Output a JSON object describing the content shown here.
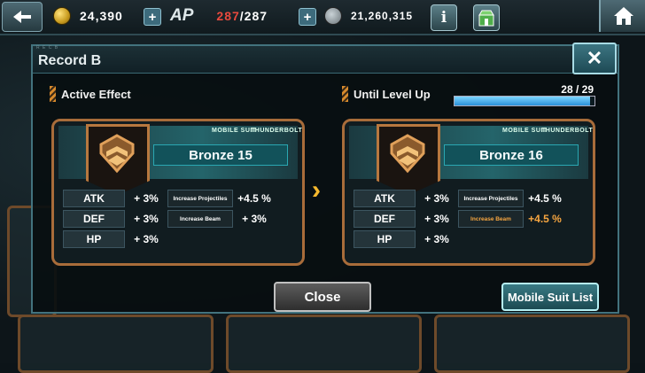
{
  "topbar": {
    "gold": "24,390",
    "ap_label": "AP",
    "ap_current": "287",
    "ap_max": "/287",
    "currency": "21,260,315",
    "info_label": "i"
  },
  "dialog": {
    "tiny_label": "R E C  B",
    "title": "Record B",
    "close_x": "✕",
    "active_effect_label": "Active Effect",
    "until_level_up_label": "Until Level Up",
    "exp_text": "28 /  29",
    "exp_fraction": 0.9655
  },
  "current": {
    "rank": "Bronze 15",
    "stats": [
      {
        "name": "ATK",
        "value": "+ 3%",
        "effect": "Increase Projectiles",
        "effect_value": "+4.5 %"
      },
      {
        "name": "DEF",
        "value": "+ 3%",
        "effect": "Increase Beam",
        "effect_value": "+ 3%"
      },
      {
        "name": "HP",
        "value": "+ 3%"
      }
    ]
  },
  "next": {
    "rank": "Bronze 16",
    "stats": [
      {
        "name": "ATK",
        "value": "+ 3%",
        "effect": "Increase Projectiles",
        "effect_value": "+4.5 %"
      },
      {
        "name": "DEF",
        "value": "+ 3%",
        "effect": "Increase Beam",
        "effect_value": "+4.5 %"
      },
      {
        "name": "HP",
        "value": "+ 3%"
      }
    ]
  },
  "buttons": {
    "close": "Close",
    "mobile_suit_list": "Mobile Suit List"
  },
  "colors": {
    "highlight": "#f7a641",
    "ap_red": "#e8493d",
    "frame_bronze": "#a86c3a"
  }
}
